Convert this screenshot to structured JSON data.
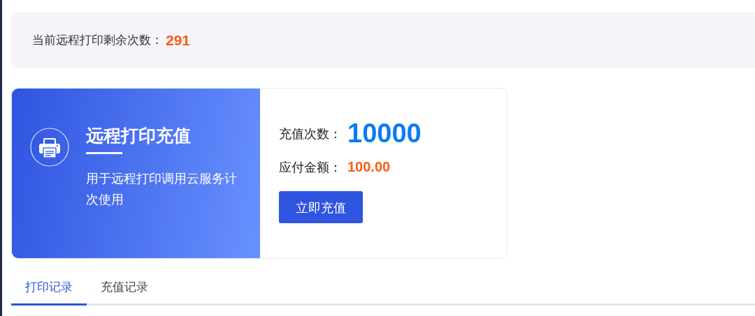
{
  "remaining": {
    "label": "当前远程打印剩余次数：",
    "value": "291"
  },
  "product": {
    "title": "远程打印充值",
    "description": "用于远程打印调用云服务计次使用"
  },
  "order": {
    "count_label": "充值次数：",
    "count": "10000",
    "amount_label": "应付金额：",
    "amount": "100.00",
    "button": "立即充值"
  },
  "tabs": [
    {
      "label": "打印记录",
      "selected": true
    },
    {
      "label": "充值记录",
      "selected": false
    }
  ]
}
